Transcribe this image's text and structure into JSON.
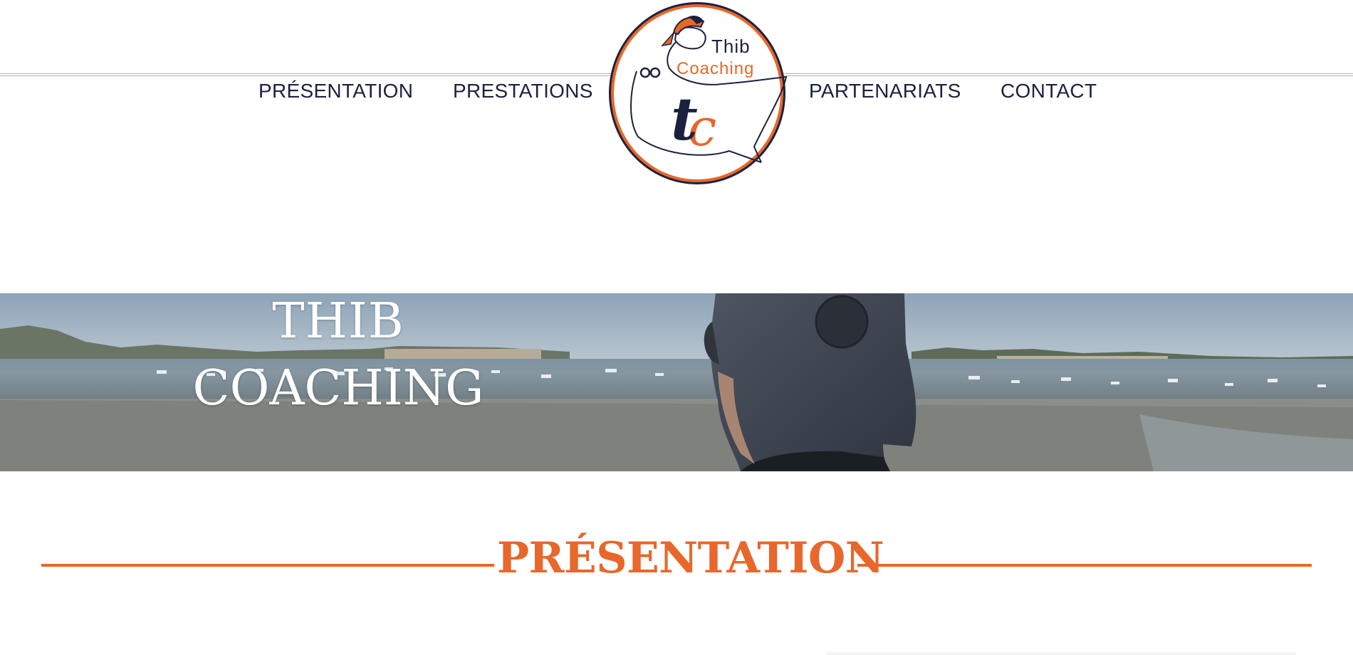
{
  "header": {
    "nav": [
      {
        "label": "PRÉSENTATION"
      },
      {
        "label": "PRESTATIONS"
      },
      {
        "label": "PARTENARIATS"
      },
      {
        "label": "CONTACT"
      }
    ],
    "logo": {
      "line1": "Thib",
      "line2": "Coaching",
      "monogram_t": "t",
      "monogram_c": "c"
    }
  },
  "hero": {
    "title_line1": "THIB",
    "title_line2": "COACHING"
  },
  "section": {
    "title": "PRÉSENTATION"
  },
  "colors": {
    "accent": "#e8672a",
    "navy": "#1b2240",
    "rule": "#e8a07c"
  }
}
